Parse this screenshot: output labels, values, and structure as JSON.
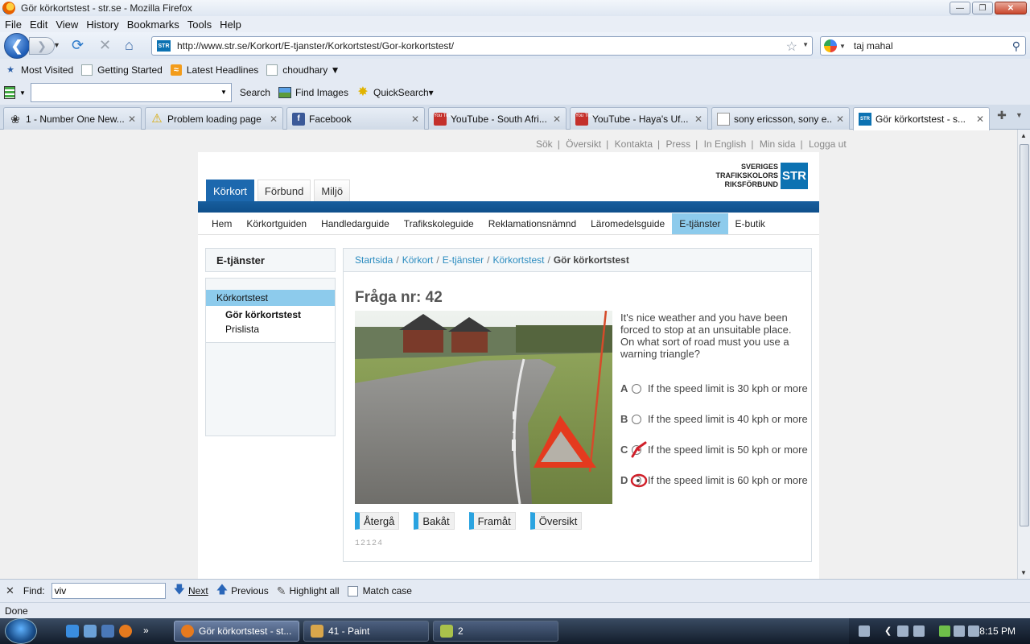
{
  "window": {
    "title": "Gör körkortstest - str.se - Mozilla Firefox"
  },
  "menu": [
    "File",
    "Edit",
    "View",
    "History",
    "Bookmarks",
    "Tools",
    "Help"
  ],
  "nav": {
    "url": "http://www.str.se/Korkort/E-tjanster/Korkortstest/Gor-korkortstest/",
    "search_value": "taj mahal",
    "site_badge": "STR"
  },
  "bookmarks": [
    "Most Visited",
    "Getting Started",
    "Latest Headlines",
    "choudhary ▼"
  ],
  "search_toolbar": {
    "search_label": "Search",
    "find_images_label": "Find Images",
    "quicksearch_label": "QuickSearch▾"
  },
  "tabs": [
    {
      "label": "1 - Number One New...",
      "icon": "nyt-icon"
    },
    {
      "label": "Problem loading page",
      "icon": "warning-icon"
    },
    {
      "label": "Facebook",
      "icon": "facebook-icon"
    },
    {
      "label": "YouTube - South Afri...",
      "icon": "youtube-icon"
    },
    {
      "label": "YouTube - Haya's Uf...",
      "icon": "youtube-icon"
    },
    {
      "label": "sony ericsson, sony e...",
      "icon": "page-icon"
    },
    {
      "label": "Gör körkortstest - s...",
      "icon": "str-icon",
      "active": true
    }
  ],
  "page": {
    "top_links": [
      "Sök",
      "Översikt",
      "Kontakta",
      "Press",
      "In English",
      "Min sida",
      "Logga ut"
    ],
    "logo": {
      "line1": "SVERIGES",
      "line2": "TRAFIKSKOLORS",
      "line3": "RIKSFÖRBUND",
      "badge": "STR"
    },
    "main_tabs": [
      "Körkort",
      "Förbund",
      "Miljö"
    ],
    "sub_nav": [
      "Hem",
      "Körkortguiden",
      "Handledarguide",
      "Trafikskoleguide",
      "Reklamationsnämnd",
      "Läromedelsguide",
      "E-tjänster",
      "E-butik"
    ],
    "sub_nav_active": "E-tjänster",
    "sidebar": {
      "title": "E-tjänster",
      "section": "Körkortstest",
      "items": [
        "Gör körkortstest",
        "Prislista"
      ]
    },
    "breadcrumbs": [
      "Startsida",
      "Körkort",
      "E-tjänster",
      "Körkortstest",
      "Gör körkortstest"
    ],
    "question": {
      "title": "Fråga nr: 42",
      "text": "It's nice weather and you have been forced to stop at an unsuitable place. On what sort of road must you use a warning triangle?",
      "options": [
        {
          "letter": "A",
          "text": "If the speed limit is 30 kph or more"
        },
        {
          "letter": "B",
          "text": "If the speed limit is 40 kph or more"
        },
        {
          "letter": "C",
          "text": "If the speed limit is 50 kph or more",
          "mark": "check"
        },
        {
          "letter": "D",
          "text": "If the speed limit is 60 kph or more",
          "mark": "circle"
        }
      ],
      "buttons": [
        "Återgå",
        "Bakåt",
        "Framåt",
        "Översikt"
      ],
      "id_code": "12124"
    }
  },
  "findbar": {
    "label": "Find:",
    "value": "viv",
    "next": "Next",
    "previous": "Previous",
    "highlight": "Highlight all",
    "match_case": "Match case"
  },
  "status": "Done",
  "taskbar": {
    "tasks": [
      "Gör körkortstest - st...",
      "41 - Paint",
      "2"
    ],
    "clock": "8:15 PM"
  },
  "colors": {
    "accent": "#1c68ae",
    "nav_active": "#8dcbec",
    "link": "#2a8bbf",
    "brand": "#0c72b2"
  }
}
